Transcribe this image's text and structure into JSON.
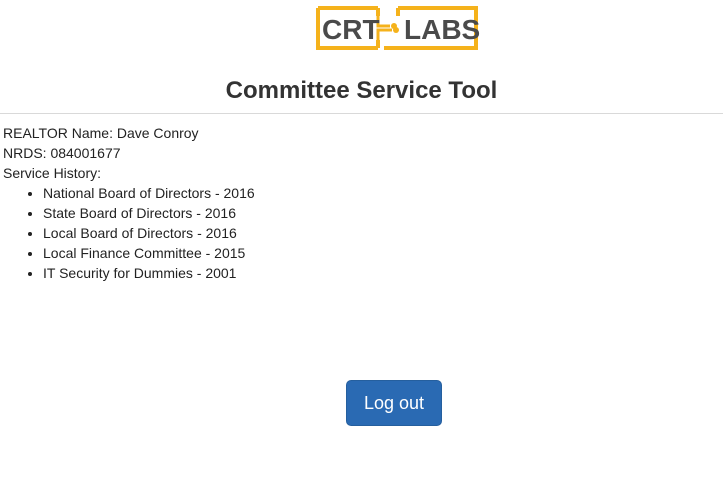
{
  "logo": {
    "left_text": "CRT",
    "right_text": "LABS",
    "accent_color": "#f5b21b",
    "text_color": "#4a4a4a"
  },
  "header": {
    "title": "Committee Service Tool"
  },
  "profile": {
    "name_line": "REALTOR Name: Dave Conroy",
    "nrds_line": "NRDS: 084001677",
    "history_heading": "Service History:",
    "history": [
      "National Board of Directors - 2016",
      "State Board of Directors - 2016",
      "Local Board of Directors - 2016",
      "Local Finance Committee - 2015",
      "IT Security for Dummies - 2001"
    ]
  },
  "actions": {
    "logout_label": "Log out",
    "button_color": "#2a6ab3"
  }
}
